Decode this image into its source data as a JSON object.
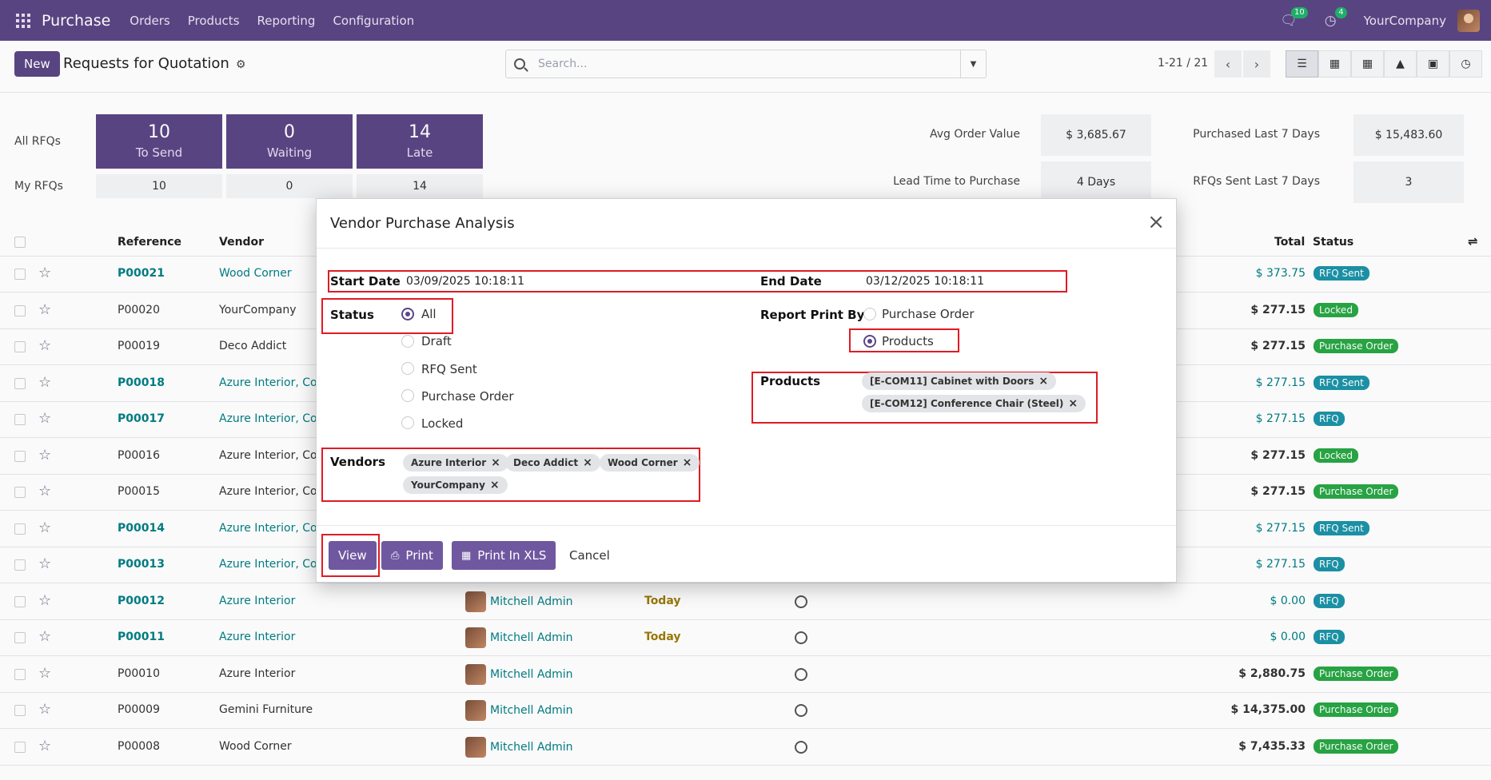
{
  "nav": {
    "app": "Purchase",
    "menu": [
      "Orders",
      "Products",
      "Reporting",
      "Configuration"
    ],
    "messages_count": "10",
    "activities_count": "4",
    "company": "YourCompany"
  },
  "control": {
    "new_label": "New",
    "title": "Requests for Quotation",
    "search_placeholder": "Search...",
    "pager": "1-21 / 21"
  },
  "dashboard": {
    "all_rfqs": "All RFQs",
    "my_rfqs": "My RFQs",
    "tiles": [
      {
        "num": "10",
        "label": "To Send",
        "mine": "10"
      },
      {
        "num": "0",
        "label": "Waiting",
        "mine": "0"
      },
      {
        "num": "14",
        "label": "Late",
        "mine": "14"
      }
    ],
    "stats": {
      "avg_order_label": "Avg Order Value",
      "avg_order_value": "$ 3,685.67",
      "purchased_label": "Purchased Last 7 Days",
      "purchased_value": "$ 15,483.60",
      "lead_label": "Lead Time to Purchase",
      "lead_value": "4  Days",
      "rfqs_sent_label": "RFQs Sent Last 7 Days",
      "rfqs_sent_value": "3"
    }
  },
  "list": {
    "headers": {
      "reference": "Reference",
      "vendor": "Vendor",
      "total": "Total",
      "status": "Status"
    },
    "rows": [
      {
        "ref": "P00021",
        "vendor": "Wood Corner",
        "total": "$ 373.75",
        "status": "RFQ Sent"
      },
      {
        "ref": "P00020",
        "vendor": "YourCompany",
        "total": "$ 277.15",
        "status": "Locked"
      },
      {
        "ref": "P00019",
        "vendor": "Deco Addict",
        "total": "$ 277.15",
        "status": "Purchase Order"
      },
      {
        "ref": "P00018",
        "vendor": "Azure Interior, Co",
        "total": "$ 277.15",
        "status": "RFQ Sent"
      },
      {
        "ref": "P00017",
        "vendor": "Azure Interior, Co",
        "total": "$ 277.15",
        "status": "RFQ"
      },
      {
        "ref": "P00016",
        "vendor": "Azure Interior, Co",
        "total": "$ 277.15",
        "status": "Locked"
      },
      {
        "ref": "P00015",
        "vendor": "Azure Interior, Co",
        "total": "$ 277.15",
        "status": "Purchase Order"
      },
      {
        "ref": "P00014",
        "vendor": "Azure Interior, Co",
        "total": "$ 277.15",
        "status": "RFQ Sent"
      },
      {
        "ref": "P00013",
        "vendor": "Azure Interior, Co",
        "total": "$ 277.15",
        "status": "RFQ"
      },
      {
        "ref": "P00012",
        "vendor": "Azure Interior",
        "buyer": "Mitchell Admin",
        "deadline": "Today",
        "total": "$ 0.00",
        "status": "RFQ"
      },
      {
        "ref": "P00011",
        "vendor": "Azure Interior",
        "buyer": "Mitchell Admin",
        "deadline": "Today",
        "total": "$ 0.00",
        "status": "RFQ"
      },
      {
        "ref": "P00010",
        "vendor": "Azure Interior",
        "buyer": "Mitchell Admin",
        "deadline": "",
        "total": "$ 2,880.75",
        "status": "Purchase Order"
      },
      {
        "ref": "P00009",
        "vendor": "Gemini Furniture",
        "buyer": "Mitchell Admin",
        "deadline": "",
        "total": "$ 14,375.00",
        "status": "Purchase Order"
      },
      {
        "ref": "P00008",
        "vendor": "Wood Corner",
        "buyer": "Mitchell Admin",
        "deadline": "",
        "total": "$ 7,435.33",
        "status": "Purchase Order"
      }
    ]
  },
  "modal": {
    "title": "Vendor Purchase Analysis",
    "start_label": "Start Date",
    "start_value": "03/09/2025 10:18:11",
    "end_label": "End Date",
    "end_value": "03/12/2025 10:18:11",
    "status_label": "Status",
    "status_options": [
      "All",
      "Draft",
      "RFQ Sent",
      "Purchase Order",
      "Locked"
    ],
    "print_by_label": "Report Print By",
    "print_by_options": [
      "Purchase Order",
      "Products"
    ],
    "products_label": "Products",
    "products": [
      "[E-COM11] Cabinet with Doors",
      "[E-COM12] Conference Chair (Steel)"
    ],
    "vendors_label": "Vendors",
    "vendors": [
      "Azure Interior",
      "Deco Addict",
      "Wood Corner",
      "YourCompany"
    ],
    "btn_view": "View",
    "btn_print": "Print",
    "btn_xls": "Print In XLS",
    "btn_cancel": "Cancel"
  }
}
